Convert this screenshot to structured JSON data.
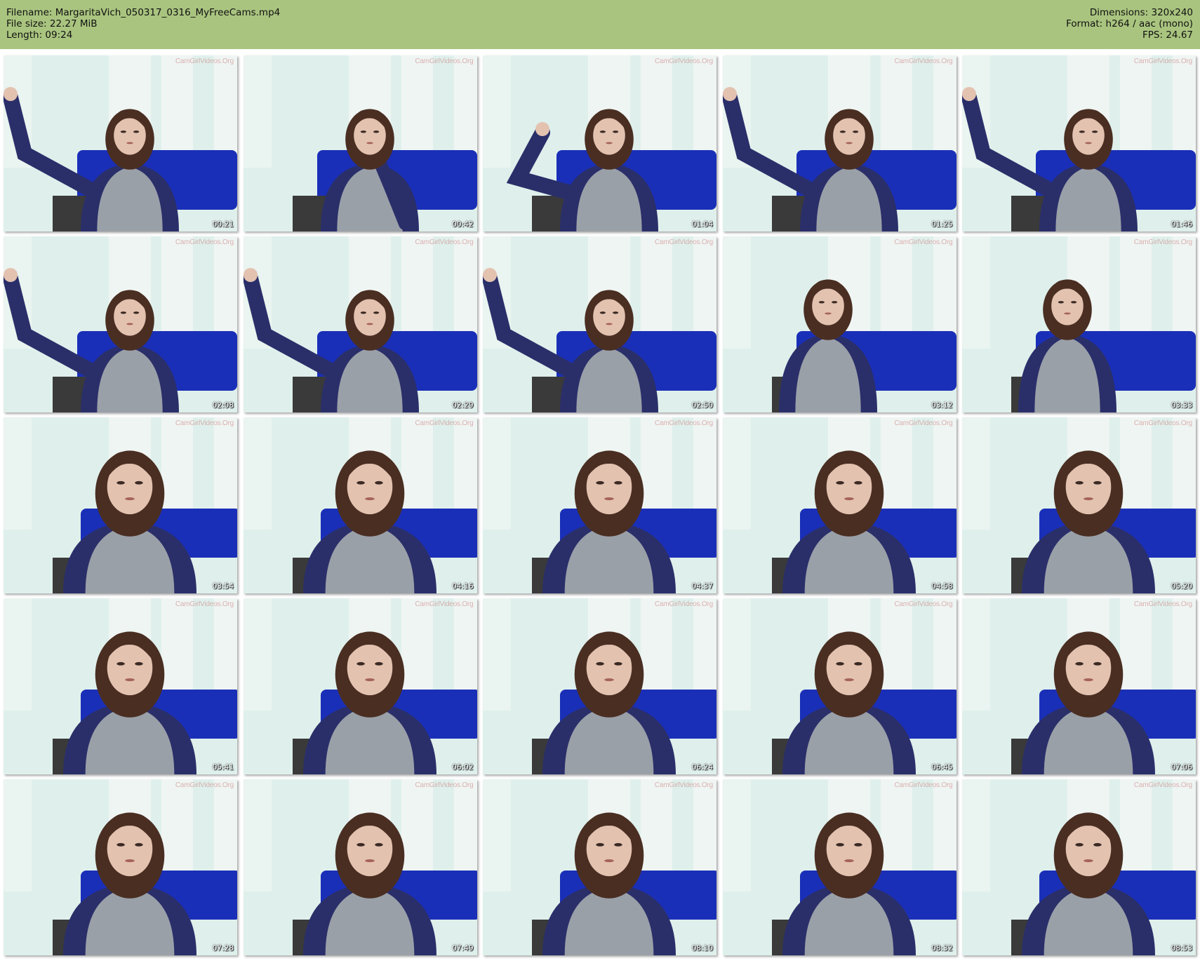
{
  "header": {
    "filename": "Filename: MargaritaVich_050317_0316_MyFreeCams.mp4",
    "file_size": "File size: 22.27 MiB",
    "length": "Length: 09:24",
    "dimensions": "Dimensions: 320x240",
    "format": "Format: h264 / aac (mono)",
    "fps": "FPS: 24.67"
  },
  "watermark": "CamGirlVideos.Org",
  "colors": {
    "header_bg": "#a9c47f",
    "wall": "#dff0ec",
    "curtain": "#f2f6f4",
    "sofa": "#1a2fb8",
    "shirt": "#9aa0a8",
    "sleeves": "#2a2f6a",
    "hair": "#4a2e22",
    "skin": "#e3c2b0"
  },
  "thumbnails": [
    {
      "time": "00:21",
      "pose": "arm-up"
    },
    {
      "time": "00:42",
      "pose": "hand-mouth"
    },
    {
      "time": "01:04",
      "pose": "fist-up"
    },
    {
      "time": "01:25",
      "pose": "arm-up"
    },
    {
      "time": "01:46",
      "pose": "arm-up"
    },
    {
      "time": "02:08",
      "pose": "arm-up"
    },
    {
      "time": "02:29",
      "pose": "arm-up"
    },
    {
      "time": "02:50",
      "pose": "arm-up"
    },
    {
      "time": "03:12",
      "pose": "lean"
    },
    {
      "time": "03:33",
      "pose": "lean"
    },
    {
      "time": "03:54",
      "pose": "close"
    },
    {
      "time": "04:16",
      "pose": "close"
    },
    {
      "time": "04:37",
      "pose": "close"
    },
    {
      "time": "04:58",
      "pose": "close"
    },
    {
      "time": "05:20",
      "pose": "close"
    },
    {
      "time": "05:41",
      "pose": "close"
    },
    {
      "time": "06:02",
      "pose": "close"
    },
    {
      "time": "06:24",
      "pose": "close"
    },
    {
      "time": "06:45",
      "pose": "close"
    },
    {
      "time": "07:06",
      "pose": "close"
    },
    {
      "time": "07:28",
      "pose": "close"
    },
    {
      "time": "07:49",
      "pose": "close"
    },
    {
      "time": "08:10",
      "pose": "close"
    },
    {
      "time": "08:32",
      "pose": "close"
    },
    {
      "time": "08:53",
      "pose": "close"
    }
  ]
}
